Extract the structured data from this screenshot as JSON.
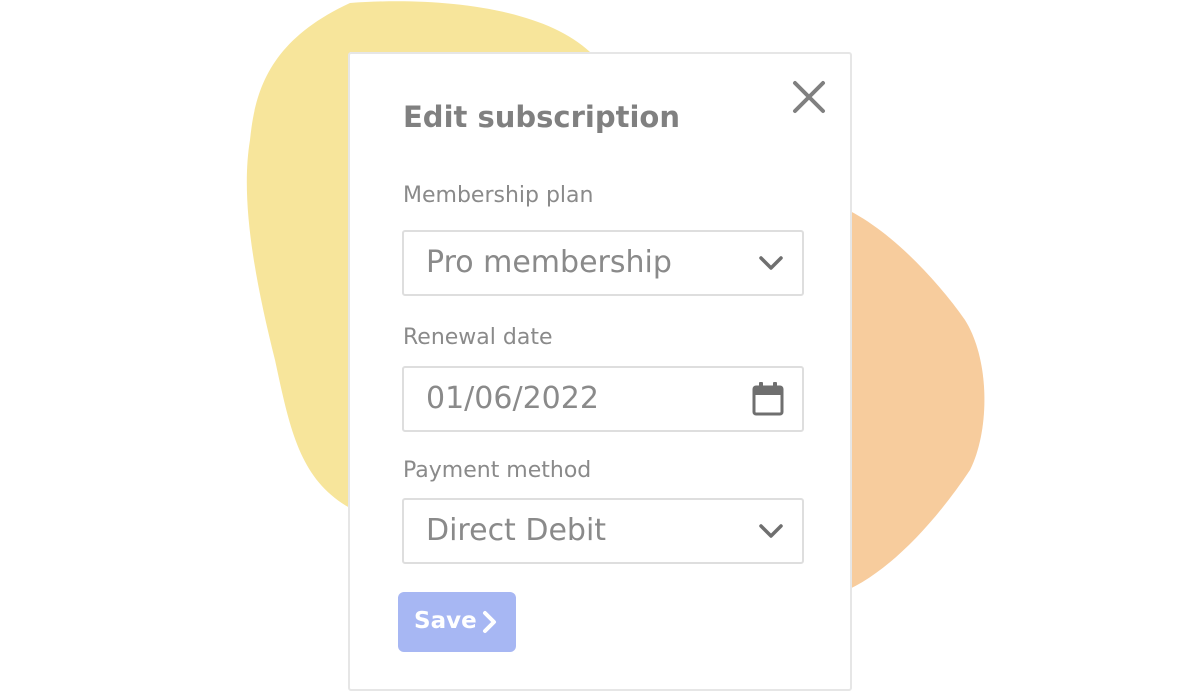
{
  "dialog": {
    "title": "Edit subscription",
    "close_icon": "close-icon"
  },
  "fields": {
    "membership_plan": {
      "label": "Membership plan",
      "value": "Pro membership",
      "icon": "chevron-down-icon"
    },
    "renewal_date": {
      "label": "Renewal date",
      "value": "01/06/2022",
      "icon": "calendar-icon"
    },
    "payment_method": {
      "label": "Payment method",
      "value": "Direct Debit",
      "icon": "chevron-down-icon"
    }
  },
  "save_button": {
    "label": "Save",
    "icon": "chevron-right-icon"
  },
  "colors": {
    "blob_yellow": "#f7e59b",
    "blob_orange": "#f7cc9d",
    "text_gray": "#808080",
    "border_gray": "#dedede",
    "save_accent": "#a7b7f3"
  }
}
